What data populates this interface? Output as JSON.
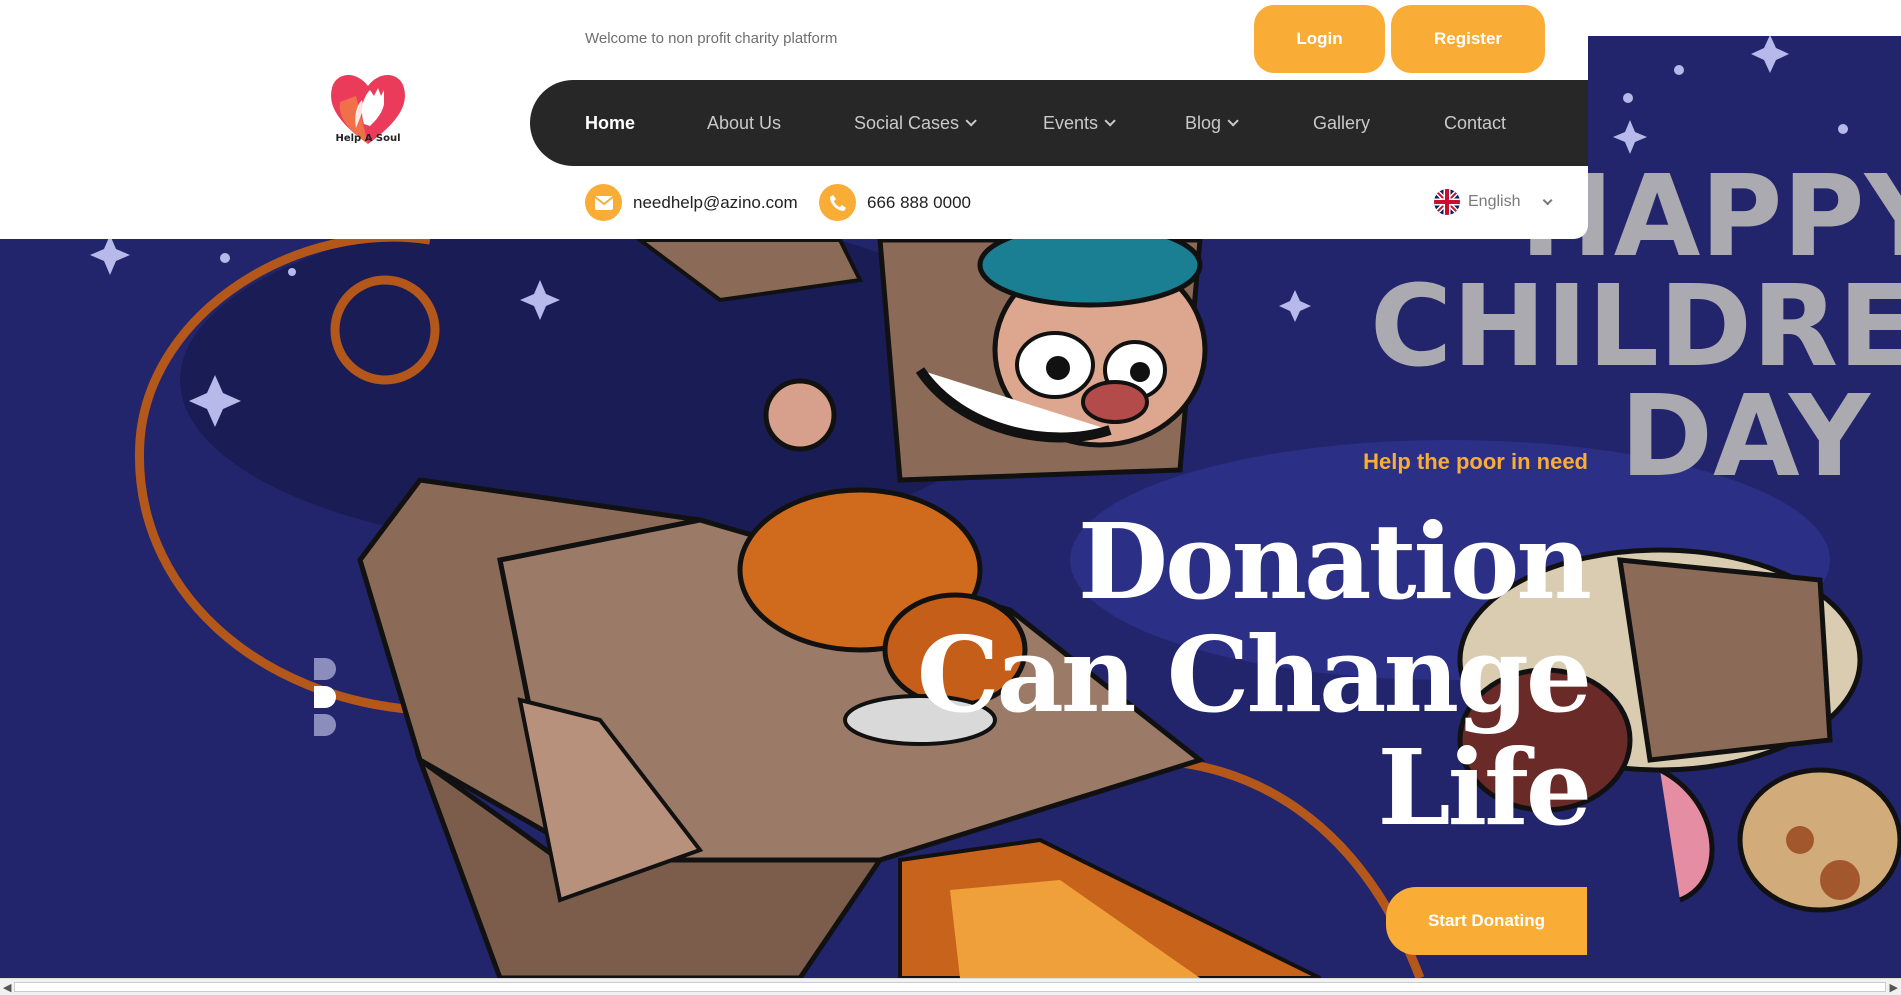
{
  "header": {
    "welcome_text": "Welcome to non profit charity platform",
    "logo_text": "Help A Soul",
    "login_label": "Login",
    "register_label": "Register"
  },
  "nav": {
    "items": [
      {
        "label": "Home",
        "active": true,
        "dropdown": false
      },
      {
        "label": "About Us",
        "active": false,
        "dropdown": false
      },
      {
        "label": "Social Cases",
        "active": false,
        "dropdown": true
      },
      {
        "label": "Events",
        "active": false,
        "dropdown": true
      },
      {
        "label": "Blog",
        "active": false,
        "dropdown": true
      },
      {
        "label": "Gallery",
        "active": false,
        "dropdown": false
      },
      {
        "label": "Contact",
        "active": false,
        "dropdown": false
      }
    ]
  },
  "contact": {
    "email": "needhelp@azino.com",
    "phone": "666 888 0000",
    "language": "English"
  },
  "hero": {
    "tagline": "Help the poor in need",
    "title_line1": "Donation",
    "title_line2": "Can Change",
    "title_line3": "Life",
    "cta_label": "Start Donating",
    "banner_lines": [
      "HAPPY",
      "CHILDREN",
      "DAY"
    ]
  },
  "colors": {
    "accent": "#f9ad36",
    "nav_bg": "#272727",
    "hero_bg": "#22256b"
  },
  "icons": [
    "heart-hands-logo-icon",
    "mail-icon",
    "phone-icon",
    "uk-flag-icon",
    "chevron-down-icon"
  ]
}
